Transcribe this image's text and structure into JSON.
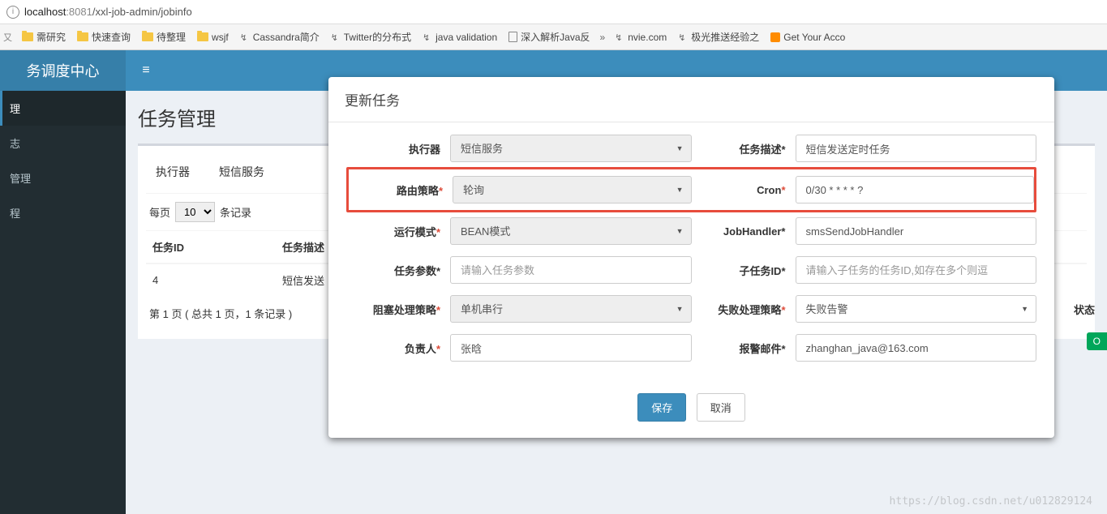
{
  "url": {
    "host": "localhost",
    "port": ":8081",
    "path": "/xxl-job-admin/jobinfo"
  },
  "bookmarks": [
    {
      "label": "需研究",
      "icon": "folder"
    },
    {
      "label": "快速查询",
      "icon": "folder"
    },
    {
      "label": "待整理",
      "icon": "folder"
    },
    {
      "label": "wsjf",
      "icon": "folder"
    },
    {
      "label": "Cassandra简介",
      "icon": "link"
    },
    {
      "label": "Twitter的分布式",
      "icon": "link"
    },
    {
      "label": "java validation",
      "icon": "link"
    },
    {
      "label": "深入解析Java反",
      "icon": "doc"
    },
    {
      "label": "nvie.com",
      "icon": "link"
    },
    {
      "label": "极光推送经验之",
      "icon": "link"
    },
    {
      "label": "Get Your Acco",
      "icon": "orange"
    }
  ],
  "header": {
    "logo": "务调度中心"
  },
  "sidebar": {
    "items": [
      {
        "label": "理",
        "active": true
      },
      {
        "label": "志",
        "active": false
      },
      {
        "label": "管理",
        "active": false
      },
      {
        "label": "程",
        "active": false
      }
    ]
  },
  "page": {
    "title": "任务管理",
    "panel_labels": {
      "executor": "执行器",
      "sms": "短信服务"
    },
    "records": {
      "prefix": "每页",
      "value": "10",
      "suffix": "条记录"
    },
    "table": {
      "headers": {
        "id": "任务ID",
        "desc": "任务描述",
        "status": "状态"
      },
      "rows": [
        {
          "id": "4",
          "desc": "短信发送"
        }
      ]
    },
    "footer": "第 1 页 ( 总共 1 页，1 条记录 )",
    "status_badge": "O"
  },
  "modal": {
    "title": "更新任务",
    "fields": {
      "executor": {
        "label": "执行器",
        "value": "短信服务"
      },
      "desc": {
        "label": "任务描述*",
        "value": "短信发送定时任务"
      },
      "route": {
        "label": "路由策略",
        "value": "轮询"
      },
      "cron": {
        "label": "Cron",
        "value": "0/30 * * * * ?"
      },
      "mode": {
        "label": "运行模式",
        "value": "BEAN模式"
      },
      "handler": {
        "label": "JobHandler*",
        "value": "smsSendJobHandler"
      },
      "params": {
        "label": "任务参数*",
        "placeholder": "请输入任务参数"
      },
      "child": {
        "label": "子任务ID*",
        "placeholder": "请输入子任务的任务ID,如存在多个则逗"
      },
      "block": {
        "label": "阻塞处理策略",
        "value": "单机串行"
      },
      "fail": {
        "label": "失败处理策略",
        "value": "失败告警"
      },
      "owner": {
        "label": "负责人",
        "value": "张晗"
      },
      "email": {
        "label": "报警邮件*",
        "value": "zhanghan_java@163.com"
      }
    },
    "buttons": {
      "save": "保存",
      "cancel": "取消"
    }
  },
  "watermark": "https://blog.csdn.net/u012829124"
}
